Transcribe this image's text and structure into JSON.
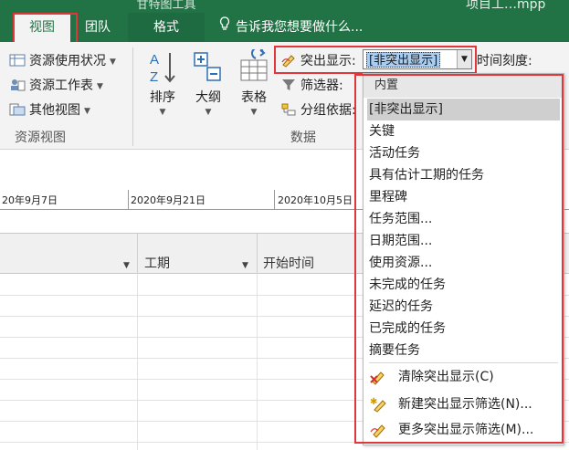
{
  "tabs": {
    "view": "视图",
    "team": "团队",
    "format": "格式",
    "context_title": "甘特图工具",
    "tell_me": "告诉我您想要做什么..."
  },
  "window": {
    "title_fragment": "项目工…mpp"
  },
  "ribbon": {
    "resource_views": {
      "resource_usage": "资源使用状况",
      "resource_sheet": "资源工作表",
      "other_views": "其他视图",
      "group_label": "资源视图"
    },
    "data": {
      "sort": "排序",
      "outline": "大纲",
      "tables": "表格",
      "highlight_label": "突出显示:",
      "highlight_value": "[非突出显示]",
      "filter_label": "筛选器:",
      "group_by_label": "分组依据:",
      "group_label": "数据"
    },
    "timescale_label": "时间刻度:"
  },
  "timeline": {
    "dates": [
      "20年9月7日",
      "2020年9月21日",
      "2020年10月5日"
    ]
  },
  "grid": {
    "columns": [
      "工期",
      "开始时间"
    ]
  },
  "highlight_menu": {
    "section_header": "内置",
    "items": [
      "[非突出显示]",
      "关键",
      "活动任务",
      "具有估计工期的任务",
      "里程碑",
      "任务范围...",
      "日期范围...",
      "使用资源...",
      "未完成的任务",
      "延迟的任务",
      "已完成的任务",
      "摘要任务"
    ],
    "commands": [
      "清除突出显示(C)",
      "新建突出显示筛选(N)...",
      "更多突出显示筛选(M)..."
    ]
  },
  "colors": {
    "tab_green": "#217346",
    "annotation_red": "#e0373b",
    "selection_blue": "#a9cdf0"
  }
}
